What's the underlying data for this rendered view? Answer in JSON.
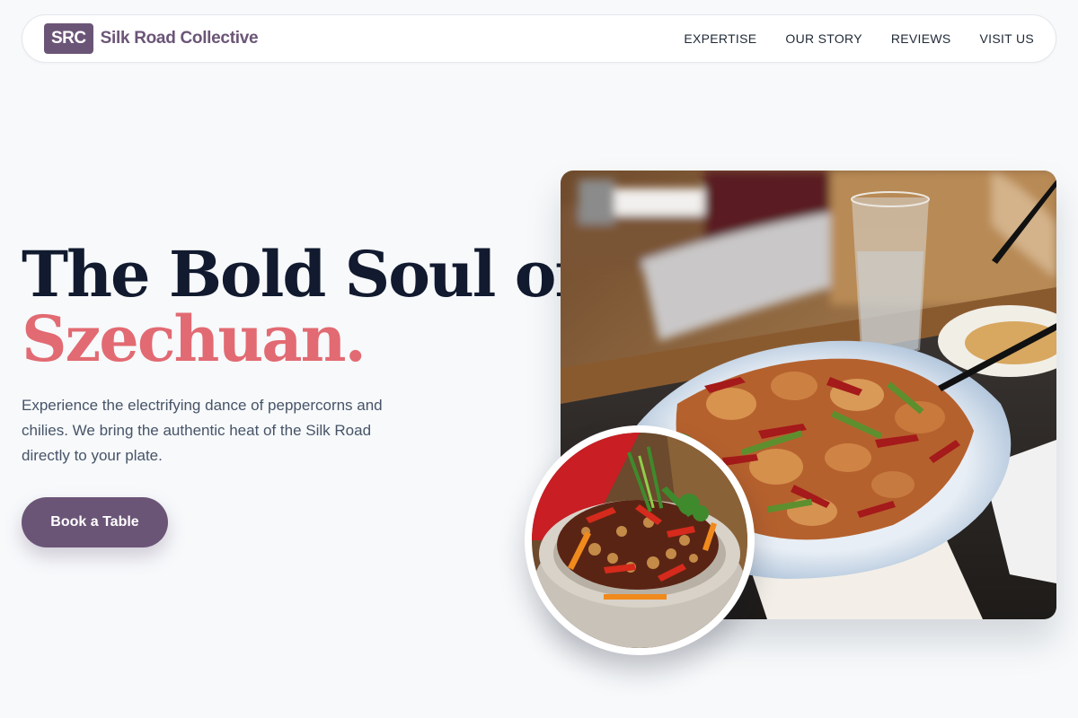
{
  "brand": {
    "mark": "SRC",
    "name": "Silk Road Collective",
    "color": "#6b5577"
  },
  "nav": {
    "items": [
      {
        "label": "EXPERTISE"
      },
      {
        "label": "OUR STORY"
      },
      {
        "label": "REVIEWS"
      },
      {
        "label": "VISIT US"
      }
    ]
  },
  "hero": {
    "title_line1": "The Bold Soul of",
    "title_line2": "Szechuan.",
    "accent_color": "#e26a72",
    "description": "Experience the electrifying dance of peppercorns and chilies. We bring the authentic heat of the Silk Road directly to your plate.",
    "cta_label": "Book a Table"
  },
  "images": {
    "main": "Szechuan spicy chicken with dried chilies on a white plate",
    "inset": "Chili chicken with peanuts in a stone bowl"
  }
}
